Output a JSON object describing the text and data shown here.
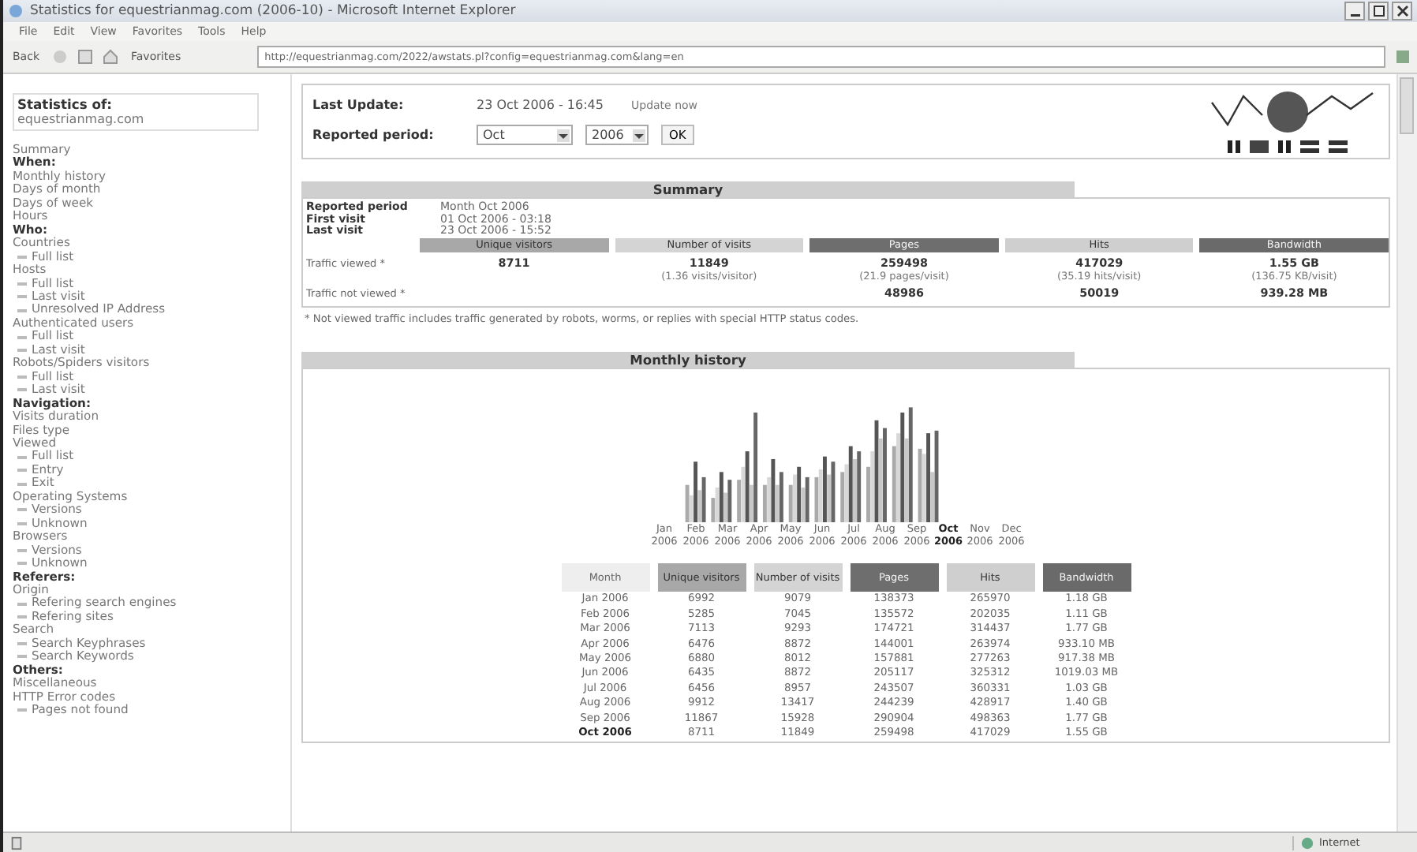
{
  "window": {
    "title": "Statistics for equestrianmag.com (2006-10) - Microsoft Internet Explorer"
  },
  "menu": [
    "File",
    "Edit",
    "View",
    "Favorites",
    "Tools",
    "Help"
  ],
  "toolbar": {
    "back": "Back",
    "favorites": "Favorites",
    "address": "http://equestrianmag.com/2022/awstats.pl?config=equestrianmag.com&lang=en"
  },
  "sidebar": {
    "title": "Statistics of:",
    "site": "equestrianmag.com",
    "items": [
      {
        "kind": "link",
        "label": "Summary"
      },
      {
        "kind": "heading",
        "label": "When:"
      },
      {
        "kind": "link",
        "label": "Monthly history"
      },
      {
        "kind": "link",
        "label": "Days of month"
      },
      {
        "kind": "link",
        "label": "Days of week"
      },
      {
        "kind": "link",
        "label": "Hours"
      },
      {
        "kind": "heading",
        "label": "Who:"
      },
      {
        "kind": "link",
        "label": "Countries"
      },
      {
        "kind": "sub",
        "label": "Full list"
      },
      {
        "kind": "link",
        "label": "Hosts"
      },
      {
        "kind": "sub",
        "label": "Full list"
      },
      {
        "kind": "sub",
        "label": "Last visit"
      },
      {
        "kind": "sub",
        "label": "Unresolved IP Address"
      },
      {
        "kind": "link",
        "label": "Authenticated users"
      },
      {
        "kind": "sub",
        "label": "Full list"
      },
      {
        "kind": "sub",
        "label": "Last visit"
      },
      {
        "kind": "link",
        "label": "Robots/Spiders visitors"
      },
      {
        "kind": "sub",
        "label": "Full list"
      },
      {
        "kind": "sub",
        "label": "Last visit"
      },
      {
        "kind": "heading",
        "label": "Navigation:"
      },
      {
        "kind": "link",
        "label": "Visits duration"
      },
      {
        "kind": "link",
        "label": "Files type"
      },
      {
        "kind": "link",
        "label": "Viewed"
      },
      {
        "kind": "sub",
        "label": "Full list"
      },
      {
        "kind": "sub",
        "label": "Entry"
      },
      {
        "kind": "sub",
        "label": "Exit"
      },
      {
        "kind": "link",
        "label": "Operating Systems"
      },
      {
        "kind": "sub",
        "label": "Versions"
      },
      {
        "kind": "sub",
        "label": "Unknown"
      },
      {
        "kind": "link",
        "label": "Browsers"
      },
      {
        "kind": "sub",
        "label": "Versions"
      },
      {
        "kind": "sub",
        "label": "Unknown"
      },
      {
        "kind": "heading",
        "label": "Referers:"
      },
      {
        "kind": "link",
        "label": "Origin"
      },
      {
        "kind": "sub",
        "label": "Refering search engines"
      },
      {
        "kind": "sub",
        "label": "Refering sites"
      },
      {
        "kind": "link",
        "label": "Search"
      },
      {
        "kind": "sub",
        "label": "Search Keyphrases"
      },
      {
        "kind": "sub",
        "label": "Search Keywords"
      },
      {
        "kind": "heading",
        "label": "Others:"
      },
      {
        "kind": "link",
        "label": "Miscellaneous"
      },
      {
        "kind": "link",
        "label": "HTTP Error codes"
      },
      {
        "kind": "sub",
        "label": "Pages not found"
      }
    ]
  },
  "header": {
    "last_update_label": "Last Update:",
    "last_update": "23 Oct 2006 - 16:45",
    "update_now": "Update now",
    "period_label": "Reported period:",
    "month": "Oct",
    "year": "2006",
    "ok": "OK"
  },
  "summary": {
    "title": "Summary",
    "info": [
      {
        "label": "Reported period",
        "value": "Month Oct 2006"
      },
      {
        "label": "First visit",
        "value": "01 Oct 2006 - 03:18"
      },
      {
        "label": "Last visit",
        "value": "23 Oct 2006 - 15:52"
      }
    ],
    "columns": [
      {
        "label": "Unique visitors",
        "color": "#a8a8a8"
      },
      {
        "label": "Number of visits",
        "color": "#d4d4d4"
      },
      {
        "label": "Pages",
        "color": "#6e6e6e"
      },
      {
        "label": "Hits",
        "color": "#cfcfcf"
      },
      {
        "label": "Bandwidth",
        "color": "#6a6a6a"
      }
    ],
    "rows": [
      {
        "label": "Traffic viewed *",
        "cells": [
          {
            "value": "8711"
          },
          {
            "value": "11849",
            "note": "(1.36 visits/visitor)"
          },
          {
            "value": "259498",
            "note": "(21.9 pages/visit)"
          },
          {
            "value": "417029",
            "note": "(35.19 hits/visit)"
          },
          {
            "value": "1.55 GB",
            "note": "(136.75 KB/visit)"
          }
        ]
      },
      {
        "label": "Traffic not viewed *",
        "cells": [
          {},
          {},
          {
            "value": "48986"
          },
          {
            "value": "50019"
          },
          {
            "value": "939.28 MB"
          }
        ]
      }
    ],
    "footnote": "* Not viewed traffic includes traffic generated by robots, worms, or replies with special HTTP status codes."
  },
  "monthly": {
    "title": "Monthly history",
    "chart_labels": [
      {
        "month": "Jan",
        "year": "2006",
        "selected": false
      },
      {
        "month": "Feb",
        "year": "2006",
        "selected": false
      },
      {
        "month": "Mar",
        "year": "2006",
        "selected": false
      },
      {
        "month": "Apr",
        "year": "2006",
        "selected": false
      },
      {
        "month": "May",
        "year": "2006",
        "selected": false
      },
      {
        "month": "Jun",
        "year": "2006",
        "selected": false
      },
      {
        "month": "Jul",
        "year": "2006",
        "selected": false
      },
      {
        "month": "Aug",
        "year": "2006",
        "selected": false
      },
      {
        "month": "Sep",
        "year": "2006",
        "selected": false
      },
      {
        "month": "Oct",
        "year": "2006",
        "selected": true
      },
      {
        "month": "Nov",
        "year": "2006",
        "selected": false
      },
      {
        "month": "Dec",
        "year": "2006",
        "selected": false
      }
    ],
    "month_heading": "Month",
    "columns": [
      {
        "label": "Unique visitors",
        "color": "#a8a8a8"
      },
      {
        "label": "Number of visits",
        "color": "#d4d4d4"
      },
      {
        "label": "Pages",
        "color": "#6e6e6e"
      },
      {
        "label": "Hits",
        "color": "#cfcfcf"
      },
      {
        "label": "Bandwidth",
        "color": "#6a6a6a"
      }
    ],
    "rows": [
      {
        "month": "Jan 2006",
        "selected": false,
        "cells": [
          "6992",
          "9079",
          "138373",
          "265970",
          "1.18 GB"
        ]
      },
      {
        "month": "Feb 2006",
        "selected": false,
        "cells": [
          "5285",
          "7045",
          "135572",
          "202035",
          "1.11 GB"
        ]
      },
      {
        "month": "Mar 2006",
        "selected": false,
        "cells": [
          "7113",
          "9293",
          "174721",
          "314437",
          "1.77 GB"
        ]
      },
      {
        "month": "Apr 2006",
        "selected": false,
        "cells": [
          "6476",
          "8872",
          "144001",
          "263974",
          "933.10 MB"
        ]
      },
      {
        "month": "May 2006",
        "selected": false,
        "cells": [
          "6880",
          "8012",
          "157881",
          "277263",
          "917.38 MB"
        ]
      },
      {
        "month": "Jun 2006",
        "selected": false,
        "cells": [
          "6435",
          "8872",
          "205117",
          "325312",
          "1019.03 MB"
        ]
      },
      {
        "month": "Jul 2006",
        "selected": false,
        "cells": [
          "6456",
          "8957",
          "243507",
          "360331",
          "1.03 GB"
        ]
      },
      {
        "month": "Aug 2006",
        "selected": false,
        "cells": [
          "9912",
          "13417",
          "244239",
          "428917",
          "1.40 GB"
        ]
      },
      {
        "month": "Sep 2006",
        "selected": false,
        "cells": [
          "11867",
          "15928",
          "290904",
          "498363",
          "1.77 GB"
        ]
      },
      {
        "month": "Oct 2006",
        "selected": true,
        "cells": [
          "8711",
          "11849",
          "259498",
          "417029",
          "1.55 GB"
        ]
      }
    ]
  },
  "status_bar": {
    "zone": "Internet"
  }
}
